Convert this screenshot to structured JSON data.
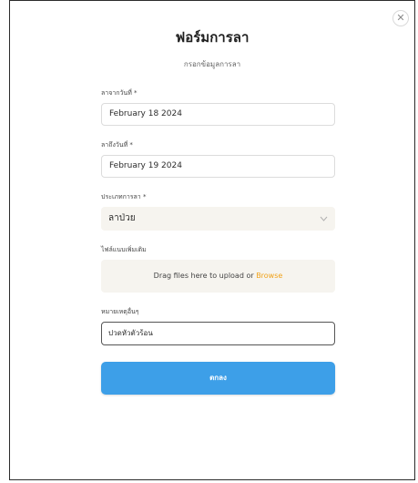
{
  "form": {
    "title": "ฟอร์มการลา",
    "subtitle": "กรอกข้อมูลการลา",
    "close_icon": "close-icon",
    "from_date": {
      "label": "ลาจากวันที่ *",
      "value": "February 18 2024"
    },
    "to_date": {
      "label": "ลาถึงวันที่ *",
      "value": "February 19 2024"
    },
    "leave_type": {
      "label": "ประเภทการลา *",
      "value": "ลาป่วย",
      "icon": "chevron-down-icon"
    },
    "attachment": {
      "label": "ไฟล์แนบเพิ่มเติม",
      "prompt": "Drag files here to upload or ",
      "browse": "Browse"
    },
    "note": {
      "label": "หมายเหตุอื่นๆ",
      "value": "ปวดหัวตัวร้อน"
    },
    "submit_label": "ตกลง"
  },
  "colors": {
    "primary": "#3d9fe8",
    "browse_link": "#f0a21a",
    "field_bg": "#f6f4ef"
  }
}
